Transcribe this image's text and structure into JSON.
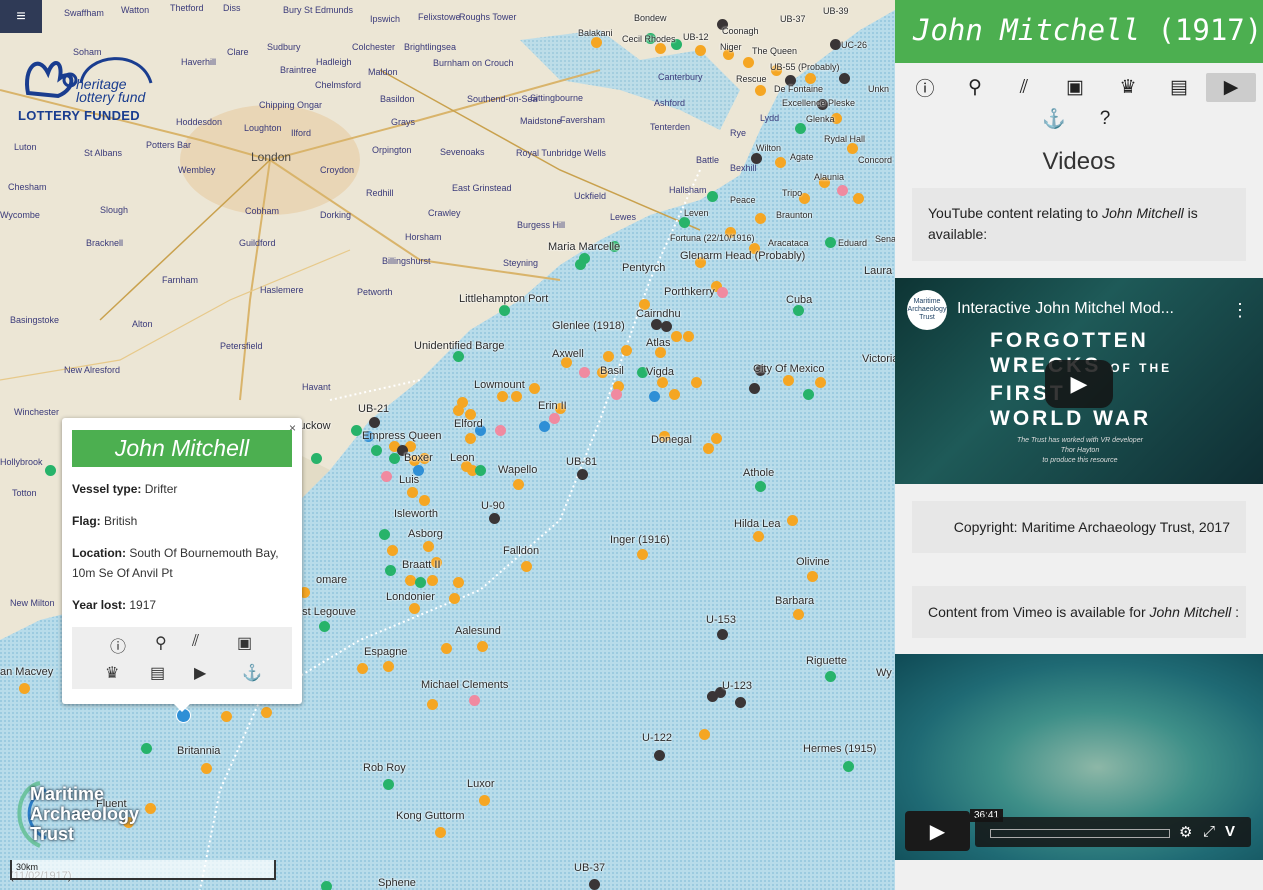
{
  "menu": {
    "label": "≡"
  },
  "logos": {
    "hlf_line1": "heritage",
    "hlf_line2": "lottery fund",
    "hlf_bottom": "LOTTERY FUNDED",
    "mat_line1": "Maritime",
    "mat_line2": "Archaeology",
    "mat_line3": "Trust"
  },
  "scale": {
    "label": "30km"
  },
  "places": [
    {
      "t": "Swaffham"
    },
    {
      "t": "Watton"
    },
    {
      "t": "Thetford"
    },
    {
      "t": "Diss"
    },
    {
      "t": "Bury St Edmunds"
    },
    {
      "t": "Ipswich"
    },
    {
      "t": "Felixstowe"
    },
    {
      "t": "Roughs Tower"
    },
    {
      "t": "Soham"
    },
    {
      "t": "Haverhill"
    },
    {
      "t": "Sudbury"
    },
    {
      "t": "Colchester"
    },
    {
      "t": "Brightlingsea"
    },
    {
      "t": "Clare"
    },
    {
      "t": "Hadleigh"
    },
    {
      "t": "Braintree"
    },
    {
      "t": "Maldon"
    },
    {
      "t": "Burnham on Crouch"
    },
    {
      "t": "Chelmsford"
    },
    {
      "t": "Basildon"
    },
    {
      "t": "Southend-on-Sea"
    },
    {
      "t": "Hoddesdon"
    },
    {
      "t": "Chipping Ongar"
    },
    {
      "t": "Loughton"
    },
    {
      "t": "Ilford"
    },
    {
      "t": "Grays"
    },
    {
      "t": "Sittingbourne"
    },
    {
      "t": "Maidstone"
    },
    {
      "t": "Faversham"
    },
    {
      "t": "Luton"
    },
    {
      "t": "St Albans"
    },
    {
      "t": "Potters Bar"
    },
    {
      "t": "London",
      "city": true
    },
    {
      "t": "Orpington"
    },
    {
      "t": "Sevenoaks"
    },
    {
      "t": "Royal Tunbridge Wells"
    },
    {
      "t": "Wembley"
    },
    {
      "t": "Croydon"
    },
    {
      "t": "Chesham"
    },
    {
      "t": "Slough"
    },
    {
      "t": "Redhill"
    },
    {
      "t": "East Grinstead"
    },
    {
      "t": "Uckfield"
    },
    {
      "t": "Crawley"
    },
    {
      "t": "Wycombe"
    },
    {
      "t": "Cobham"
    },
    {
      "t": "Dorking"
    },
    {
      "t": "Bracknell"
    },
    {
      "t": "Guildford"
    },
    {
      "t": "Horsham"
    },
    {
      "t": "Burgess Hill"
    },
    {
      "t": "Lewes"
    },
    {
      "t": "Hallsham"
    },
    {
      "t": "Farnham"
    },
    {
      "t": "Billingshurst"
    },
    {
      "t": "Steyning"
    },
    {
      "t": "Haslemere"
    },
    {
      "t": "Basingstoke"
    },
    {
      "t": "Alton"
    },
    {
      "t": "Petworth"
    },
    {
      "t": "Petersfield"
    },
    {
      "t": "New Alresford"
    },
    {
      "t": "Winchester"
    },
    {
      "t": "Havant"
    },
    {
      "t": "Canterbury"
    },
    {
      "t": "Ashford"
    },
    {
      "t": "Tenterden"
    },
    {
      "t": "Rye"
    },
    {
      "t": "Battle"
    },
    {
      "t": "Lydd"
    },
    {
      "t": "Hollybrook"
    },
    {
      "t": "Totton"
    },
    {
      "t": "New Milton"
    },
    {
      "t": "Bexhill"
    }
  ],
  "wrecks": [
    {
      "t": "Bondew"
    },
    {
      "t": "UB-37"
    },
    {
      "t": "UB-39"
    },
    {
      "t": "Balakani"
    },
    {
      "t": "Cecil Rhodes"
    },
    {
      "t": "UB-12"
    },
    {
      "t": "Coonagh"
    },
    {
      "t": "Niger"
    },
    {
      "t": "The Queen"
    },
    {
      "t": "UC-26"
    },
    {
      "t": "UB-55 (Probably)"
    },
    {
      "t": "Rescue"
    },
    {
      "t": "De Fontaine"
    },
    {
      "t": "Unkn"
    },
    {
      "t": "Excellence Pleske"
    },
    {
      "t": "Glenka"
    },
    {
      "t": "Rydal Hall"
    },
    {
      "t": "Wilton"
    },
    {
      "t": "Agate"
    },
    {
      "t": "Concord"
    },
    {
      "t": "Alaunia"
    },
    {
      "t": "Tripo"
    },
    {
      "t": "Peace"
    },
    {
      "t": "Braunton"
    },
    {
      "t": "Leven"
    },
    {
      "t": "Fortuna (22/10/1916)"
    },
    {
      "t": "Aracataca"
    },
    {
      "t": "Eduard"
    },
    {
      "t": "Maria Marcelle"
    },
    {
      "t": "Glenarm Head (Probably)"
    },
    {
      "t": "Pentyrch"
    },
    {
      "t": "Laura"
    },
    {
      "t": "Porthkerry"
    },
    {
      "t": "Cuba"
    },
    {
      "t": "Littlehampton Port"
    },
    {
      "t": "Cairndhu"
    },
    {
      "t": "Glenlee (1918)"
    },
    {
      "t": "Atlas"
    },
    {
      "t": "Unidentified Barge"
    },
    {
      "t": "Axwell"
    },
    {
      "t": "Basil"
    },
    {
      "t": "Vigda"
    },
    {
      "t": "City Of Mexico"
    },
    {
      "t": "Victoria"
    },
    {
      "t": "Lowmount"
    },
    {
      "t": "UB-21"
    },
    {
      "t": "Erin II"
    },
    {
      "t": "Elford"
    },
    {
      "t": "Empress Queen"
    },
    {
      "t": "Donegal"
    },
    {
      "t": "Boxer"
    },
    {
      "t": "Leon"
    },
    {
      "t": "UB-81"
    },
    {
      "t": "Wapello"
    },
    {
      "t": "Athole"
    },
    {
      "t": "Luis"
    },
    {
      "t": "U-90"
    },
    {
      "t": "Isleworth"
    },
    {
      "t": "Hilda Lea"
    },
    {
      "t": "Asborg"
    },
    {
      "t": "Inger (1916)"
    },
    {
      "t": "Falldon"
    },
    {
      "t": "Olivine"
    },
    {
      "t": "Braatt II"
    },
    {
      "t": "Londonier"
    },
    {
      "t": "Barbara"
    },
    {
      "t": "U-153"
    },
    {
      "t": "Aalesund"
    },
    {
      "t": "Espagne"
    },
    {
      "t": "Riguette"
    },
    {
      "t": "Michael Clements"
    },
    {
      "t": "U-123"
    },
    {
      "t": "U-122"
    },
    {
      "t": "Britannia"
    },
    {
      "t": "Hermes (1915)"
    },
    {
      "t": "Rob Roy"
    },
    {
      "t": "Luxor"
    },
    {
      "t": "Fluent"
    },
    {
      "t": "Kong Guttorm"
    },
    {
      "t": "UB-37"
    },
    {
      "t": "Sphene"
    },
    {
      "t": "omare"
    },
    {
      "t": "est Legouve"
    },
    {
      "t": "an Macvey"
    },
    {
      "t": "Kuckow"
    },
    {
      "t": "(11/02/1917)"
    },
    {
      "t": "Sena"
    },
    {
      "t": "Wy"
    }
  ],
  "popup": {
    "title": "John Mitchell",
    "close": "×",
    "fields": [
      {
        "label": "Vessel type:",
        "value": "Drifter"
      },
      {
        "label": "Flag:",
        "value": "British"
      },
      {
        "label": "Location:",
        "value": "South Of Bournemouth Bay, 10m Se Of Anvil Pt"
      },
      {
        "label": "Year lost:",
        "value": "1917"
      }
    ]
  },
  "sidebar": {
    "title_name": "John Mitchell",
    "title_year": "(1917)",
    "heading": "Videos",
    "youtube_text_1": "YouTube content relating to ",
    "youtube_text_name": "John Mitchell",
    "youtube_text_2": " is available:",
    "copyright": "Copyright: Maritime Archaeology Trust, 2017",
    "vimeo_text_1": "Content from Vimeo is available for ",
    "vimeo_text_name": "John Mitchell",
    "vimeo_text_2": " :"
  },
  "youtube": {
    "title": "Interactive John Mitchel Mod...",
    "channel": "Maritime Archaeology Trust",
    "line1": "FORGOTTEN",
    "line2": "WRECKS",
    "line2b": "OF THE",
    "line3": "FIRST",
    "line4": "WORLD WAR",
    "sub1": "The Trust has worked with VR developer",
    "sub2": "Thor Hayton",
    "sub3": "to produce this resource"
  },
  "vimeo": {
    "time": "36:41"
  },
  "colors": {
    "green": "#4caf50",
    "orange": "#f5a623",
    "dark": "#3a3536",
    "sea": "#a9d4e6"
  }
}
